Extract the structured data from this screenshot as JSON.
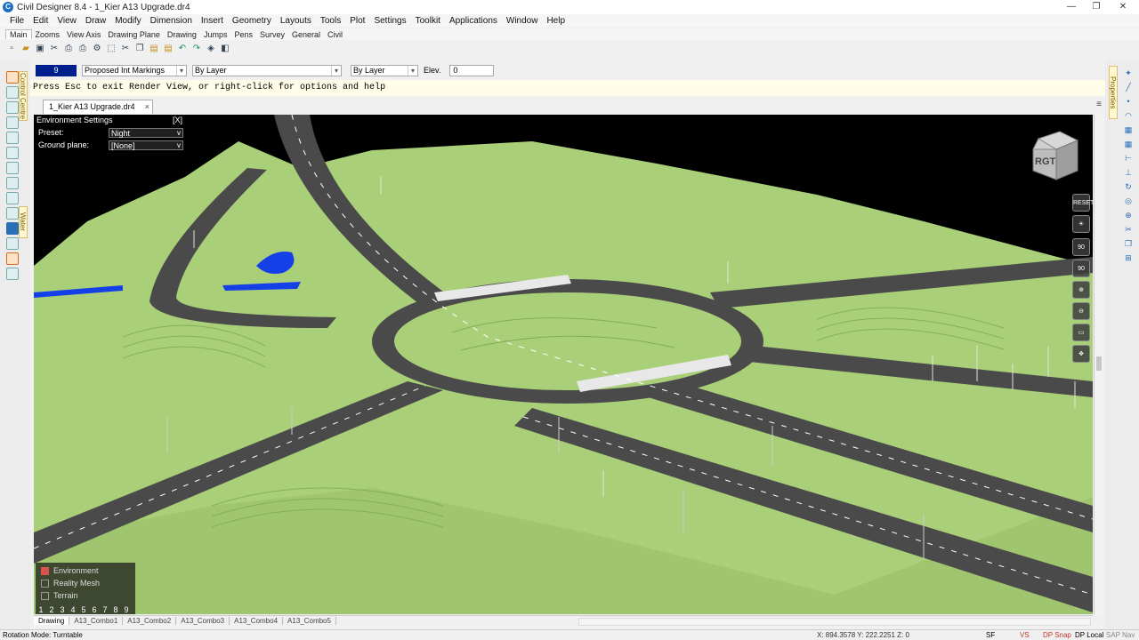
{
  "title": "Civil Designer 8.4 - 1_Kier A13 Upgrade.dr4",
  "window_controls": {
    "minimize": "—",
    "maximize": "❐",
    "close": "✕"
  },
  "menu": [
    "File",
    "Edit",
    "View",
    "Draw",
    "Modify",
    "Dimension",
    "Insert",
    "Geometry",
    "Layouts",
    "Tools",
    "Plot",
    "Settings",
    "Toolkit",
    "Applications",
    "Window",
    "Help"
  ],
  "ribbon_tabs": [
    "Main",
    "Zooms",
    "View Axis",
    "Drawing Plane",
    "Drawing",
    "Jumps",
    "Pens",
    "Survey",
    "General",
    "Civil"
  ],
  "properties_bar": {
    "layer_number": "9",
    "layer_name": "Proposed Int Markings",
    "pen": "By Layer",
    "linetype": "By Layer",
    "elev_label": "Elev.",
    "elev_value": "0"
  },
  "command_line": "Press Esc to exit Render View, or right-click for options and help",
  "document_tab": "1_Kier A13 Upgrade.dr4",
  "environment_panel": {
    "title": "Environment Settings",
    "close": "[X]",
    "preset_label": "Preset:",
    "preset_value": "Night",
    "ground_label": "Ground plane:",
    "ground_value": "[None]"
  },
  "layers_panel": [
    {
      "label": "Environment",
      "checked": true
    },
    {
      "label": "Reality Mesh",
      "checked": false
    },
    {
      "label": "Terrain",
      "checked": false
    }
  ],
  "page_numbers": [
    "1",
    "2",
    "3",
    "4",
    "5",
    "6",
    "7",
    "8",
    "9"
  ],
  "nav": {
    "cube_label": "RGT",
    "reset": "RESET",
    "rot1": "90",
    "rot2": "90"
  },
  "left_side_tabs": [
    "Control Centre",
    "Water"
  ],
  "right_side_tab": "Properties",
  "sheet_tabs": [
    "Drawing",
    "A13_Combo1",
    "A13_Combo2",
    "A13_Combo3",
    "A13_Combo4",
    "A13_Combo5"
  ],
  "status": {
    "mode": "Rotation Mode: Turntable",
    "coords": "X: 894.3578 Y: 222.2251 Z: 0",
    "items": [
      "SF",
      "VS",
      "DP Snap",
      "DP Local",
      "SAP Nav"
    ]
  },
  "colors": {
    "grass": "#a7cf74",
    "road": "#4a4a4a",
    "sky": "#000000",
    "water": "#1540e8",
    "layer_blue": "#001e8c"
  }
}
